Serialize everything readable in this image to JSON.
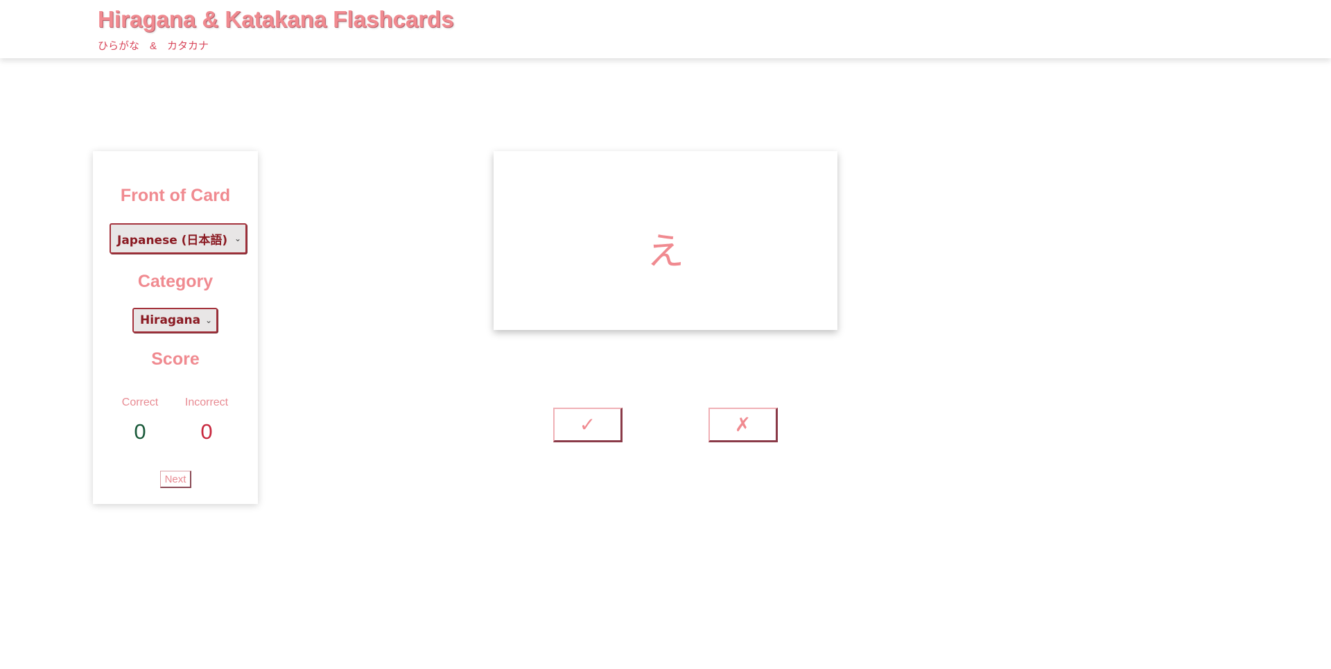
{
  "header": {
    "title": "Hiragana & Katakana Flashcards",
    "subtitle": "ひらがな　&　カタカナ"
  },
  "sidebar": {
    "front_heading": "Front of Card",
    "front_select": "Japanese (日本語)",
    "category_heading": "Category",
    "category_select": "Hiragana",
    "score_heading": "Score",
    "correct_label": "Correct",
    "incorrect_label": "Incorrect",
    "correct_value": "0",
    "incorrect_value": "0",
    "next_label": "Next"
  },
  "card": {
    "character": "え"
  },
  "buttons": {
    "correct_symbol": "✓",
    "incorrect_symbol": "✗"
  },
  "icons": {
    "select_chevron": "chevron-down-icon",
    "correct": "check-icon",
    "incorrect": "cross-icon"
  },
  "colors": {
    "accent": "#f08a90",
    "correct": "#1a5a3a",
    "incorrect": "#c8283e"
  }
}
